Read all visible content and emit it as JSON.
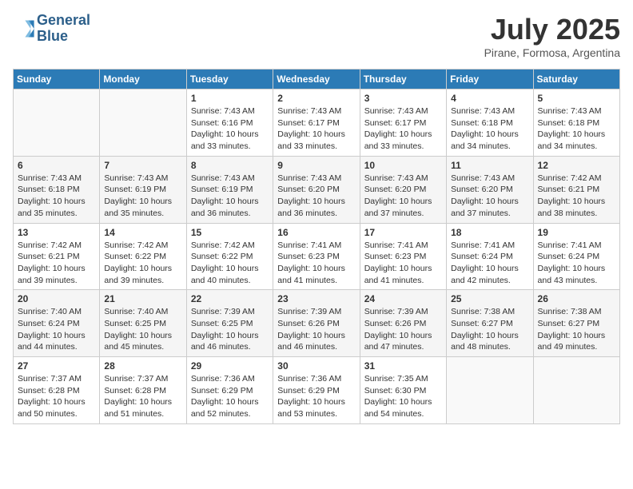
{
  "logo": {
    "line1": "General",
    "line2": "Blue"
  },
  "title": "July 2025",
  "subtitle": "Pirane, Formosa, Argentina",
  "headers": [
    "Sunday",
    "Monday",
    "Tuesday",
    "Wednesday",
    "Thursday",
    "Friday",
    "Saturday"
  ],
  "weeks": [
    [
      {
        "day": "",
        "info": ""
      },
      {
        "day": "",
        "info": ""
      },
      {
        "day": "1",
        "info": "Sunrise: 7:43 AM\nSunset: 6:16 PM\nDaylight: 10 hours\nand 33 minutes."
      },
      {
        "day": "2",
        "info": "Sunrise: 7:43 AM\nSunset: 6:17 PM\nDaylight: 10 hours\nand 33 minutes."
      },
      {
        "day": "3",
        "info": "Sunrise: 7:43 AM\nSunset: 6:17 PM\nDaylight: 10 hours\nand 33 minutes."
      },
      {
        "day": "4",
        "info": "Sunrise: 7:43 AM\nSunset: 6:18 PM\nDaylight: 10 hours\nand 34 minutes."
      },
      {
        "day": "5",
        "info": "Sunrise: 7:43 AM\nSunset: 6:18 PM\nDaylight: 10 hours\nand 34 minutes."
      }
    ],
    [
      {
        "day": "6",
        "info": "Sunrise: 7:43 AM\nSunset: 6:18 PM\nDaylight: 10 hours\nand 35 minutes."
      },
      {
        "day": "7",
        "info": "Sunrise: 7:43 AM\nSunset: 6:19 PM\nDaylight: 10 hours\nand 35 minutes."
      },
      {
        "day": "8",
        "info": "Sunrise: 7:43 AM\nSunset: 6:19 PM\nDaylight: 10 hours\nand 36 minutes."
      },
      {
        "day": "9",
        "info": "Sunrise: 7:43 AM\nSunset: 6:20 PM\nDaylight: 10 hours\nand 36 minutes."
      },
      {
        "day": "10",
        "info": "Sunrise: 7:43 AM\nSunset: 6:20 PM\nDaylight: 10 hours\nand 37 minutes."
      },
      {
        "day": "11",
        "info": "Sunrise: 7:43 AM\nSunset: 6:20 PM\nDaylight: 10 hours\nand 37 minutes."
      },
      {
        "day": "12",
        "info": "Sunrise: 7:42 AM\nSunset: 6:21 PM\nDaylight: 10 hours\nand 38 minutes."
      }
    ],
    [
      {
        "day": "13",
        "info": "Sunrise: 7:42 AM\nSunset: 6:21 PM\nDaylight: 10 hours\nand 39 minutes."
      },
      {
        "day": "14",
        "info": "Sunrise: 7:42 AM\nSunset: 6:22 PM\nDaylight: 10 hours\nand 39 minutes."
      },
      {
        "day": "15",
        "info": "Sunrise: 7:42 AM\nSunset: 6:22 PM\nDaylight: 10 hours\nand 40 minutes."
      },
      {
        "day": "16",
        "info": "Sunrise: 7:41 AM\nSunset: 6:23 PM\nDaylight: 10 hours\nand 41 minutes."
      },
      {
        "day": "17",
        "info": "Sunrise: 7:41 AM\nSunset: 6:23 PM\nDaylight: 10 hours\nand 41 minutes."
      },
      {
        "day": "18",
        "info": "Sunrise: 7:41 AM\nSunset: 6:24 PM\nDaylight: 10 hours\nand 42 minutes."
      },
      {
        "day": "19",
        "info": "Sunrise: 7:41 AM\nSunset: 6:24 PM\nDaylight: 10 hours\nand 43 minutes."
      }
    ],
    [
      {
        "day": "20",
        "info": "Sunrise: 7:40 AM\nSunset: 6:24 PM\nDaylight: 10 hours\nand 44 minutes."
      },
      {
        "day": "21",
        "info": "Sunrise: 7:40 AM\nSunset: 6:25 PM\nDaylight: 10 hours\nand 45 minutes."
      },
      {
        "day": "22",
        "info": "Sunrise: 7:39 AM\nSunset: 6:25 PM\nDaylight: 10 hours\nand 46 minutes."
      },
      {
        "day": "23",
        "info": "Sunrise: 7:39 AM\nSunset: 6:26 PM\nDaylight: 10 hours\nand 46 minutes."
      },
      {
        "day": "24",
        "info": "Sunrise: 7:39 AM\nSunset: 6:26 PM\nDaylight: 10 hours\nand 47 minutes."
      },
      {
        "day": "25",
        "info": "Sunrise: 7:38 AM\nSunset: 6:27 PM\nDaylight: 10 hours\nand 48 minutes."
      },
      {
        "day": "26",
        "info": "Sunrise: 7:38 AM\nSunset: 6:27 PM\nDaylight: 10 hours\nand 49 minutes."
      }
    ],
    [
      {
        "day": "27",
        "info": "Sunrise: 7:37 AM\nSunset: 6:28 PM\nDaylight: 10 hours\nand 50 minutes."
      },
      {
        "day": "28",
        "info": "Sunrise: 7:37 AM\nSunset: 6:28 PM\nDaylight: 10 hours\nand 51 minutes."
      },
      {
        "day": "29",
        "info": "Sunrise: 7:36 AM\nSunset: 6:29 PM\nDaylight: 10 hours\nand 52 minutes."
      },
      {
        "day": "30",
        "info": "Sunrise: 7:36 AM\nSunset: 6:29 PM\nDaylight: 10 hours\nand 53 minutes."
      },
      {
        "day": "31",
        "info": "Sunrise: 7:35 AM\nSunset: 6:30 PM\nDaylight: 10 hours\nand 54 minutes."
      },
      {
        "day": "",
        "info": ""
      },
      {
        "day": "",
        "info": ""
      }
    ]
  ]
}
